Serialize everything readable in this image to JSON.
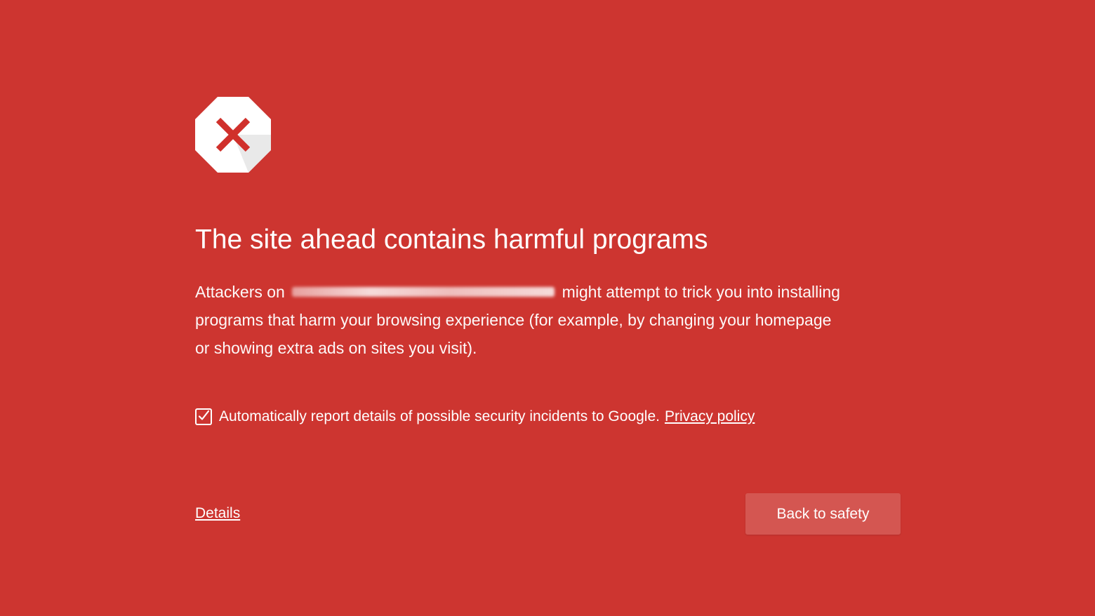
{
  "page": {
    "background_color": "#cd3530",
    "accent_button_color": "#d45651"
  },
  "icon": {
    "name": "stop-x-icon"
  },
  "title": "The site ahead contains harmful programs",
  "body": {
    "prefix": "Attackers on",
    "redacted_site": "",
    "suffix_line1": "might attempt to trick you into installing",
    "line2": "programs that harm your browsing experience (for example, by changing your homepage",
    "line3": "or showing extra ads on sites you visit)."
  },
  "report": {
    "checked": true,
    "label": "Automatically report details of possible security incidents to Google.",
    "privacy_link": "Privacy policy"
  },
  "details_link": "Details",
  "back_button": "Back to safety"
}
